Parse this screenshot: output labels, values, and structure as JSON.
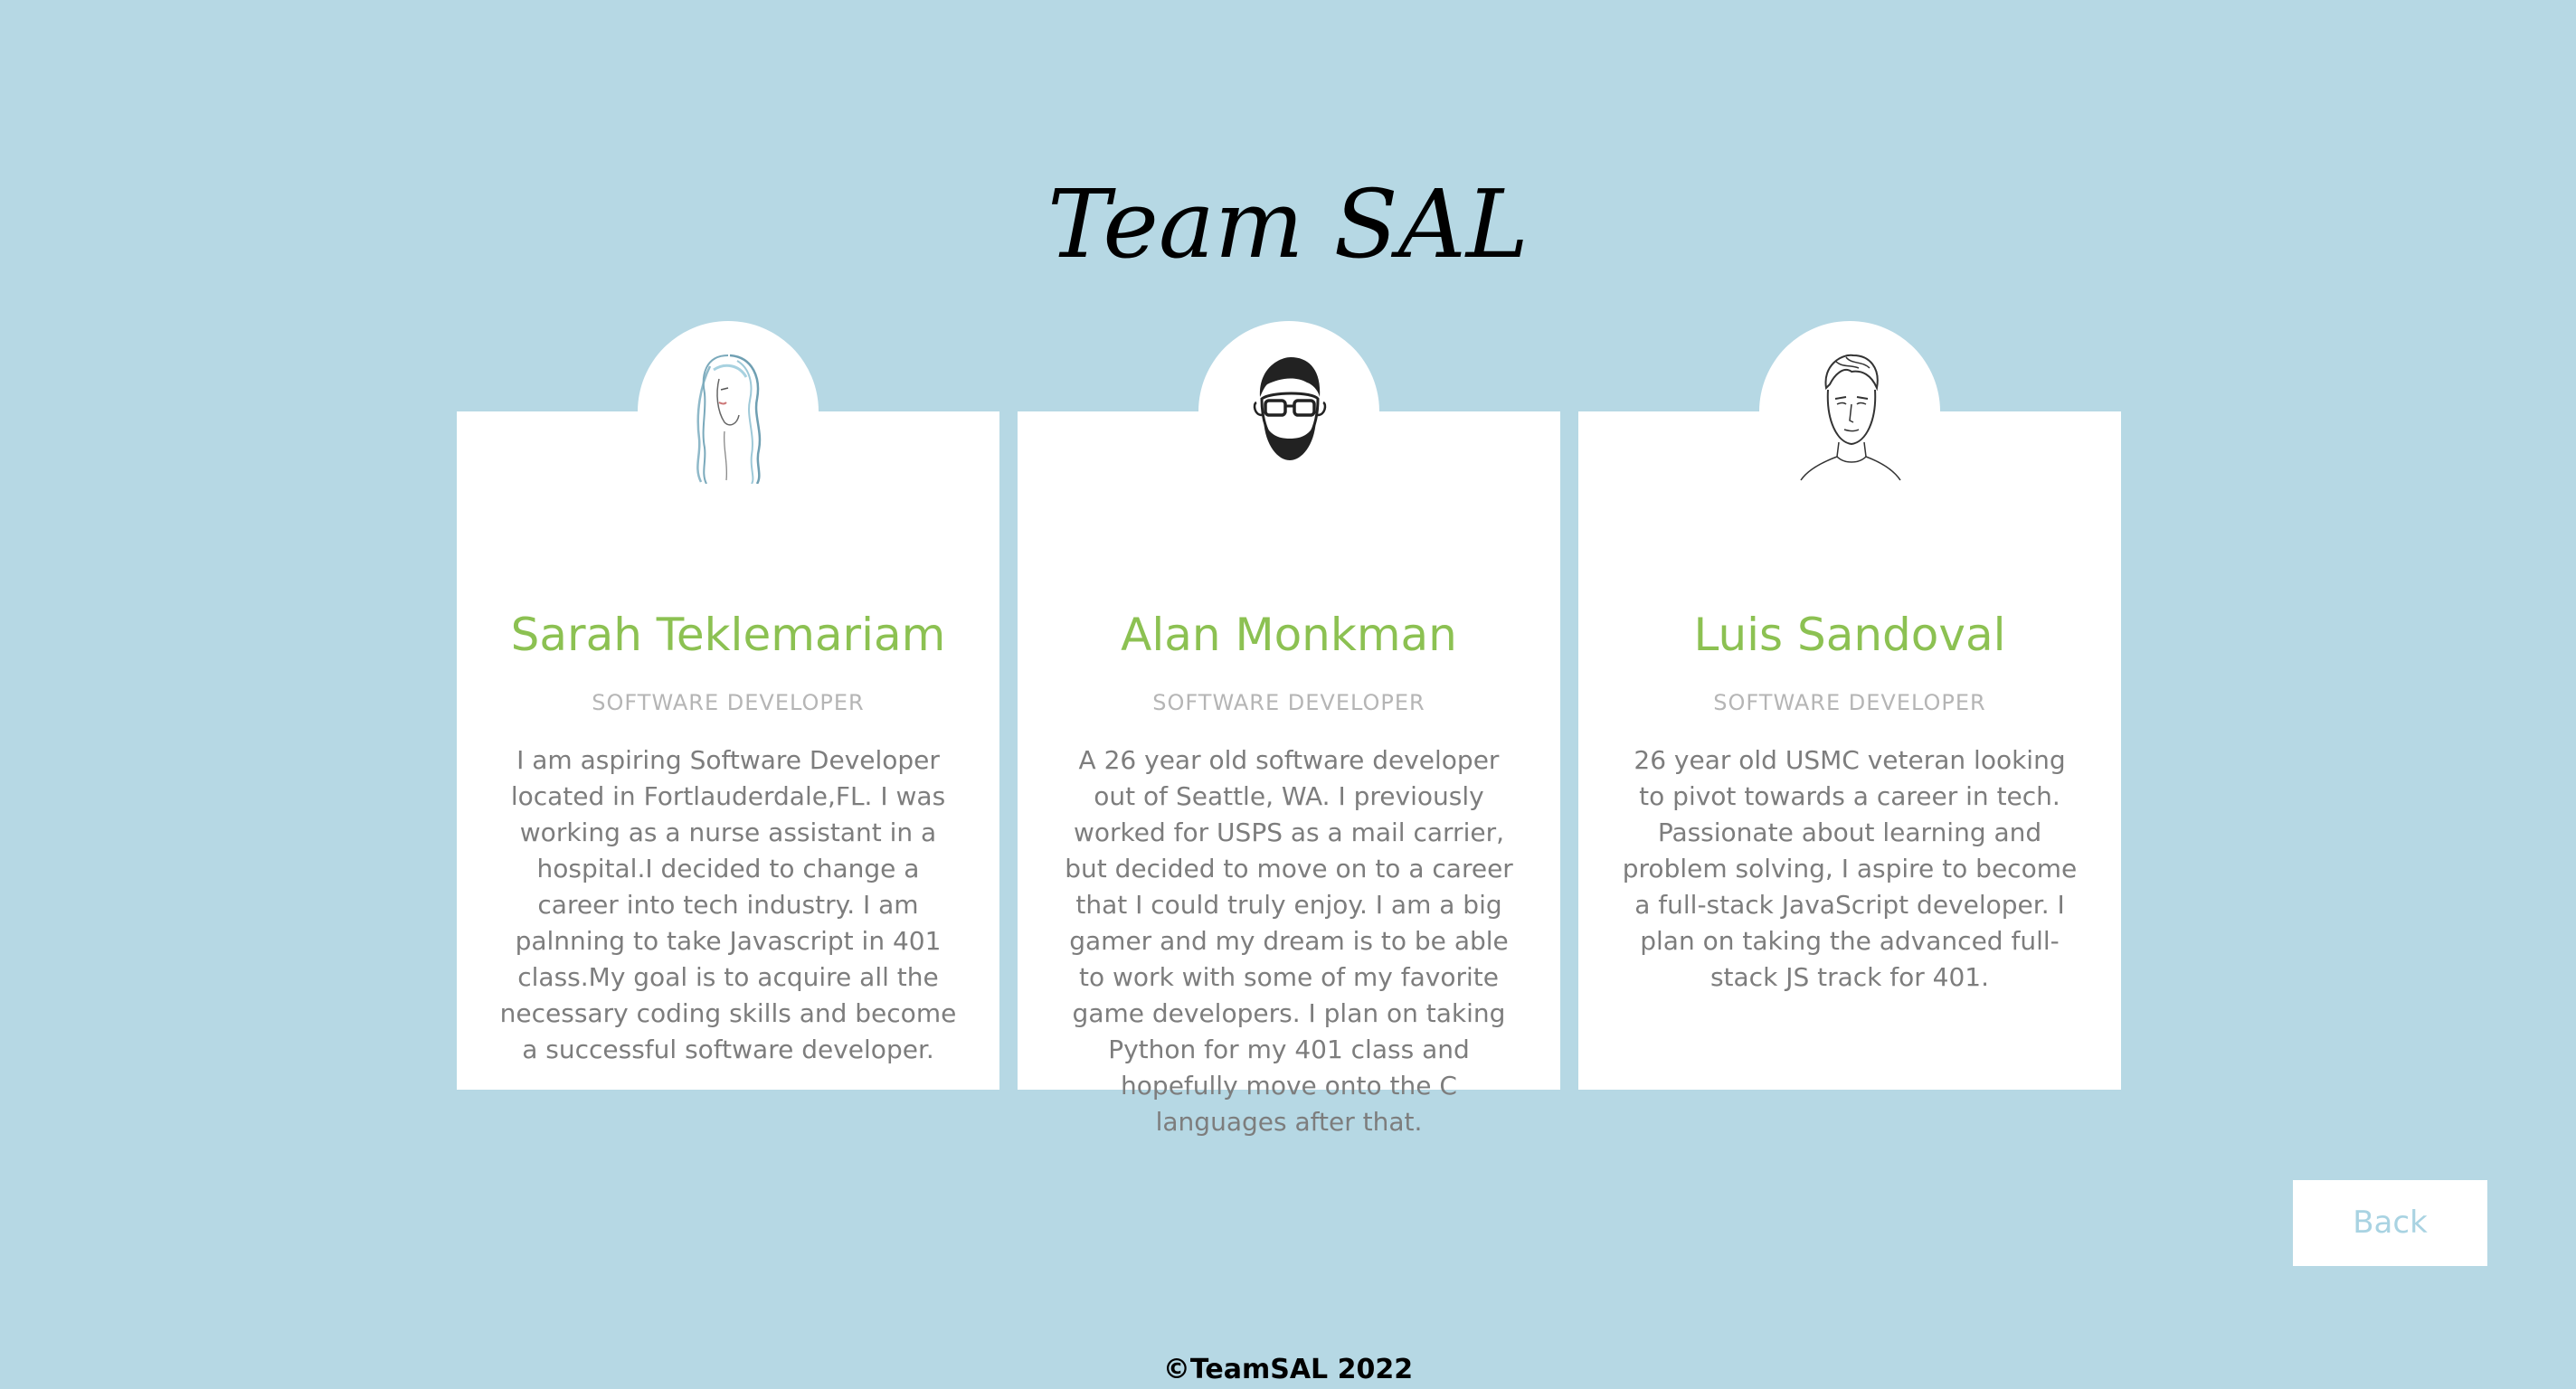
{
  "page": {
    "title": "Team SAL",
    "footer": "©TeamSAL 2022"
  },
  "colors": {
    "background": "#b6d8e4",
    "card": "#ffffff",
    "name": "#8cc152",
    "role": "#b5b5b5",
    "bio": "#7d7d7d",
    "back_text": "#a9d3e2"
  },
  "members": [
    {
      "name": "Sarah Teklemariam",
      "role": "SOFTWARE DEVELOPER",
      "bio": "I am aspiring Software Developer located in Fortlauderdale,FL. I was working as a nurse assistant in a hospital.I decided to change a career into tech industry. I am palnning to take Javascript in 401 class.My goal is to acquire all the necessary coding skills and become a successful software developer.",
      "avatar_icon": "woman-sketch-avatar-icon"
    },
    {
      "name": "Alan Monkman",
      "role": "SOFTWARE DEVELOPER",
      "bio": "A 26 year old software developer out of Seattle, WA. I previously worked for USPS as a mail carrier, but decided to move on to a career that I could truly enjoy. I am a big gamer and my dream is to be able to work with some of my favorite game developers. I plan on taking Python for my 401 class and hopefully move onto the C languages after that.",
      "avatar_icon": "bearded-man-glasses-avatar-icon"
    },
    {
      "name": "Luis Sandoval",
      "role": "SOFTWARE DEVELOPER",
      "bio": "26 year old USMC veteran looking to pivot towards a career in tech. Passionate about learning and problem solving, I aspire to become a full-stack JavaScript developer. I plan on taking the advanced full-stack JS track for 401.",
      "avatar_icon": "man-sketch-avatar-icon"
    }
  ],
  "back_button": {
    "label": "Back"
  }
}
